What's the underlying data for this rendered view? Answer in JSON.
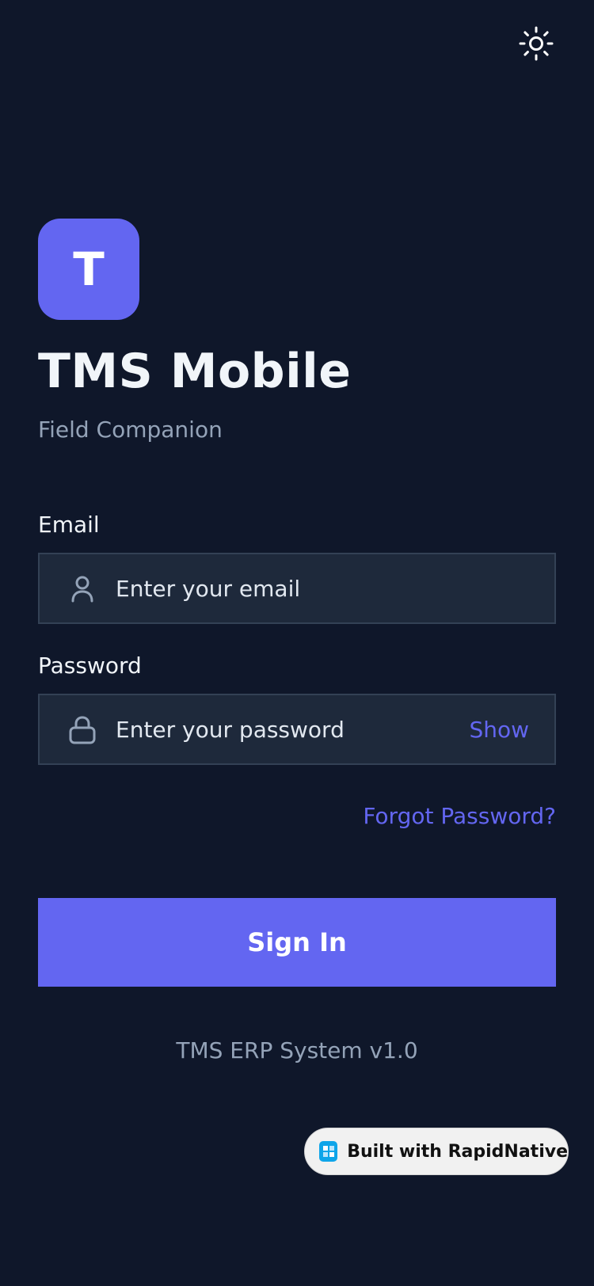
{
  "header": {
    "theme_toggle_icon": "sun-icon"
  },
  "brand": {
    "logo_letter": "T",
    "logo_color": "#6366f1",
    "title": "TMS Mobile",
    "subtitle": "Field Companion"
  },
  "form": {
    "email": {
      "label": "Email",
      "placeholder": "Enter your email",
      "icon": "user-icon"
    },
    "password": {
      "label": "Password",
      "placeholder": "Enter your password",
      "icon": "lock-icon",
      "show_label": "Show"
    },
    "forgot_password": "Forgot Password?",
    "submit_label": "Sign In"
  },
  "footer": {
    "version": "TMS ERP System v1.0"
  },
  "badge": {
    "label": "Built with RapidNative"
  },
  "colors": {
    "background": "#0f172a",
    "accent": "#6366f1",
    "input_bg": "#1e293b",
    "muted_text": "#94a3b8"
  }
}
